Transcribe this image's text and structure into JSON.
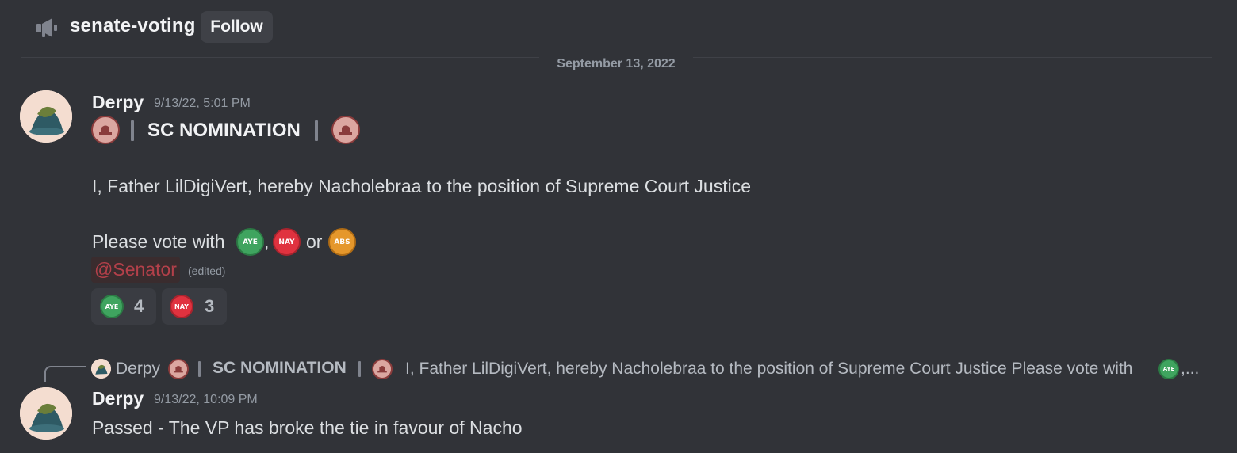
{
  "header": {
    "channel_icon": "megaphone-icon",
    "channel_name": "senate-voting",
    "follow_label": "Follow"
  },
  "date_divider": "September 13, 2022",
  "messages": [
    {
      "author": "Derpy",
      "timestamp": "9/13/22, 5:01 PM",
      "title": "SC NOMINATION",
      "line1": "I, Father LilDigiVert, hereby Nacholebraa to the position of Supreme Court Justice",
      "vote_prefix": "Please vote with",
      "vote_comma": ",",
      "vote_or": "or",
      "mention": "@Senator",
      "edited": "(edited)",
      "reactions": [
        {
          "emoji": "AYE",
          "count": "4"
        },
        {
          "emoji": "NAY",
          "count": "3"
        }
      ]
    },
    {
      "reply": {
        "author": "Derpy",
        "title": "SC NOMINATION",
        "text": "I, Father LilDigiVert, hereby Nacholebraa to the position of Supreme Court Justice  Please vote with",
        "suffix": ",..."
      },
      "author": "Derpy",
      "timestamp": "9/13/22, 10:09 PM",
      "text": "Passed - The VP has broke the tie in favour of Nacho"
    }
  ],
  "emoji_labels": {
    "aye": "AYE",
    "nay": "NAY",
    "abs": "ABS"
  },
  "colors": {
    "background": "#313338",
    "aye": "#3fa45f",
    "nay": "#e0323f",
    "abs": "#e5972b",
    "mention": "#b4404a"
  }
}
